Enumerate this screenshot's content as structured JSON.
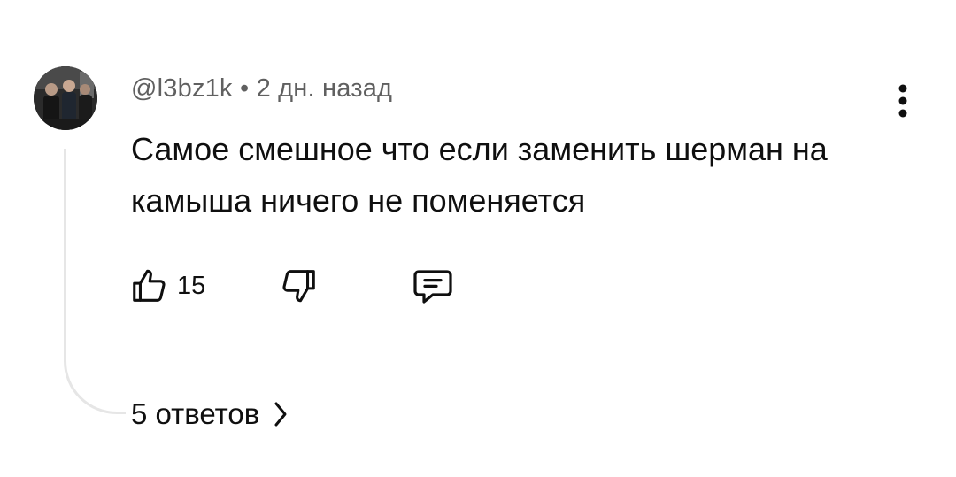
{
  "comment": {
    "author": "@l3bz1k",
    "separator": "•",
    "time_ago": "2 дн. назад",
    "text": "Самое смешное что если заменить шерман на камыша ничего не поменяется",
    "like_count": "15",
    "replies_label": "5 ответов"
  },
  "icons": {
    "avatar": "avatar-photo",
    "more": "more-vert-icon",
    "like": "thumb-up-icon",
    "dislike": "thumb-down-icon",
    "reply": "comment-icon",
    "chevron": "chevron-right-icon"
  },
  "colors": {
    "text": "#0f0f0f",
    "secondary_text": "#606060",
    "thread_line": "#e6e6e6",
    "background": "#ffffff"
  }
}
